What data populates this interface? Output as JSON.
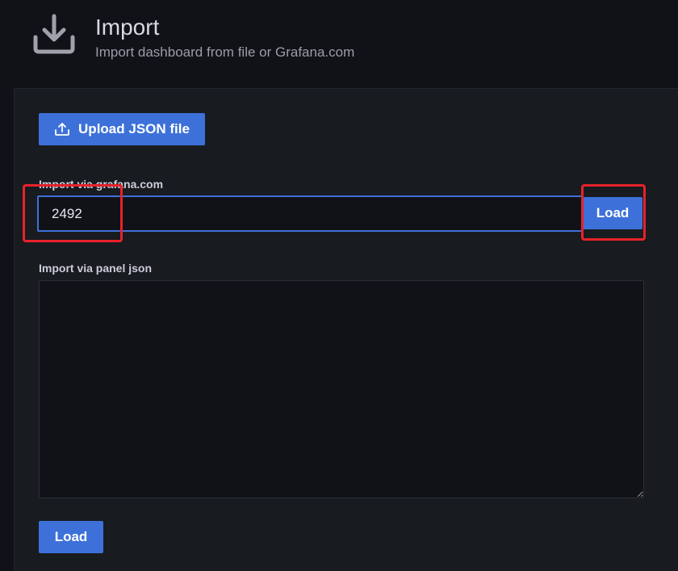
{
  "header": {
    "title": "Import",
    "subtitle": "Import dashboard from file or Grafana.com",
    "icon": "import-download-icon"
  },
  "upload": {
    "label": "Upload JSON file",
    "icon": "upload-icon"
  },
  "grafana_com": {
    "label": "Import via grafana.com",
    "value": "2492",
    "load_label": "Load"
  },
  "panel_json": {
    "label": "Import via panel json",
    "value": "",
    "load_label": "Load"
  },
  "colors": {
    "accent": "#3d71d9",
    "background": "#111217",
    "panel": "#181b1f",
    "highlight": "#e8222a"
  }
}
